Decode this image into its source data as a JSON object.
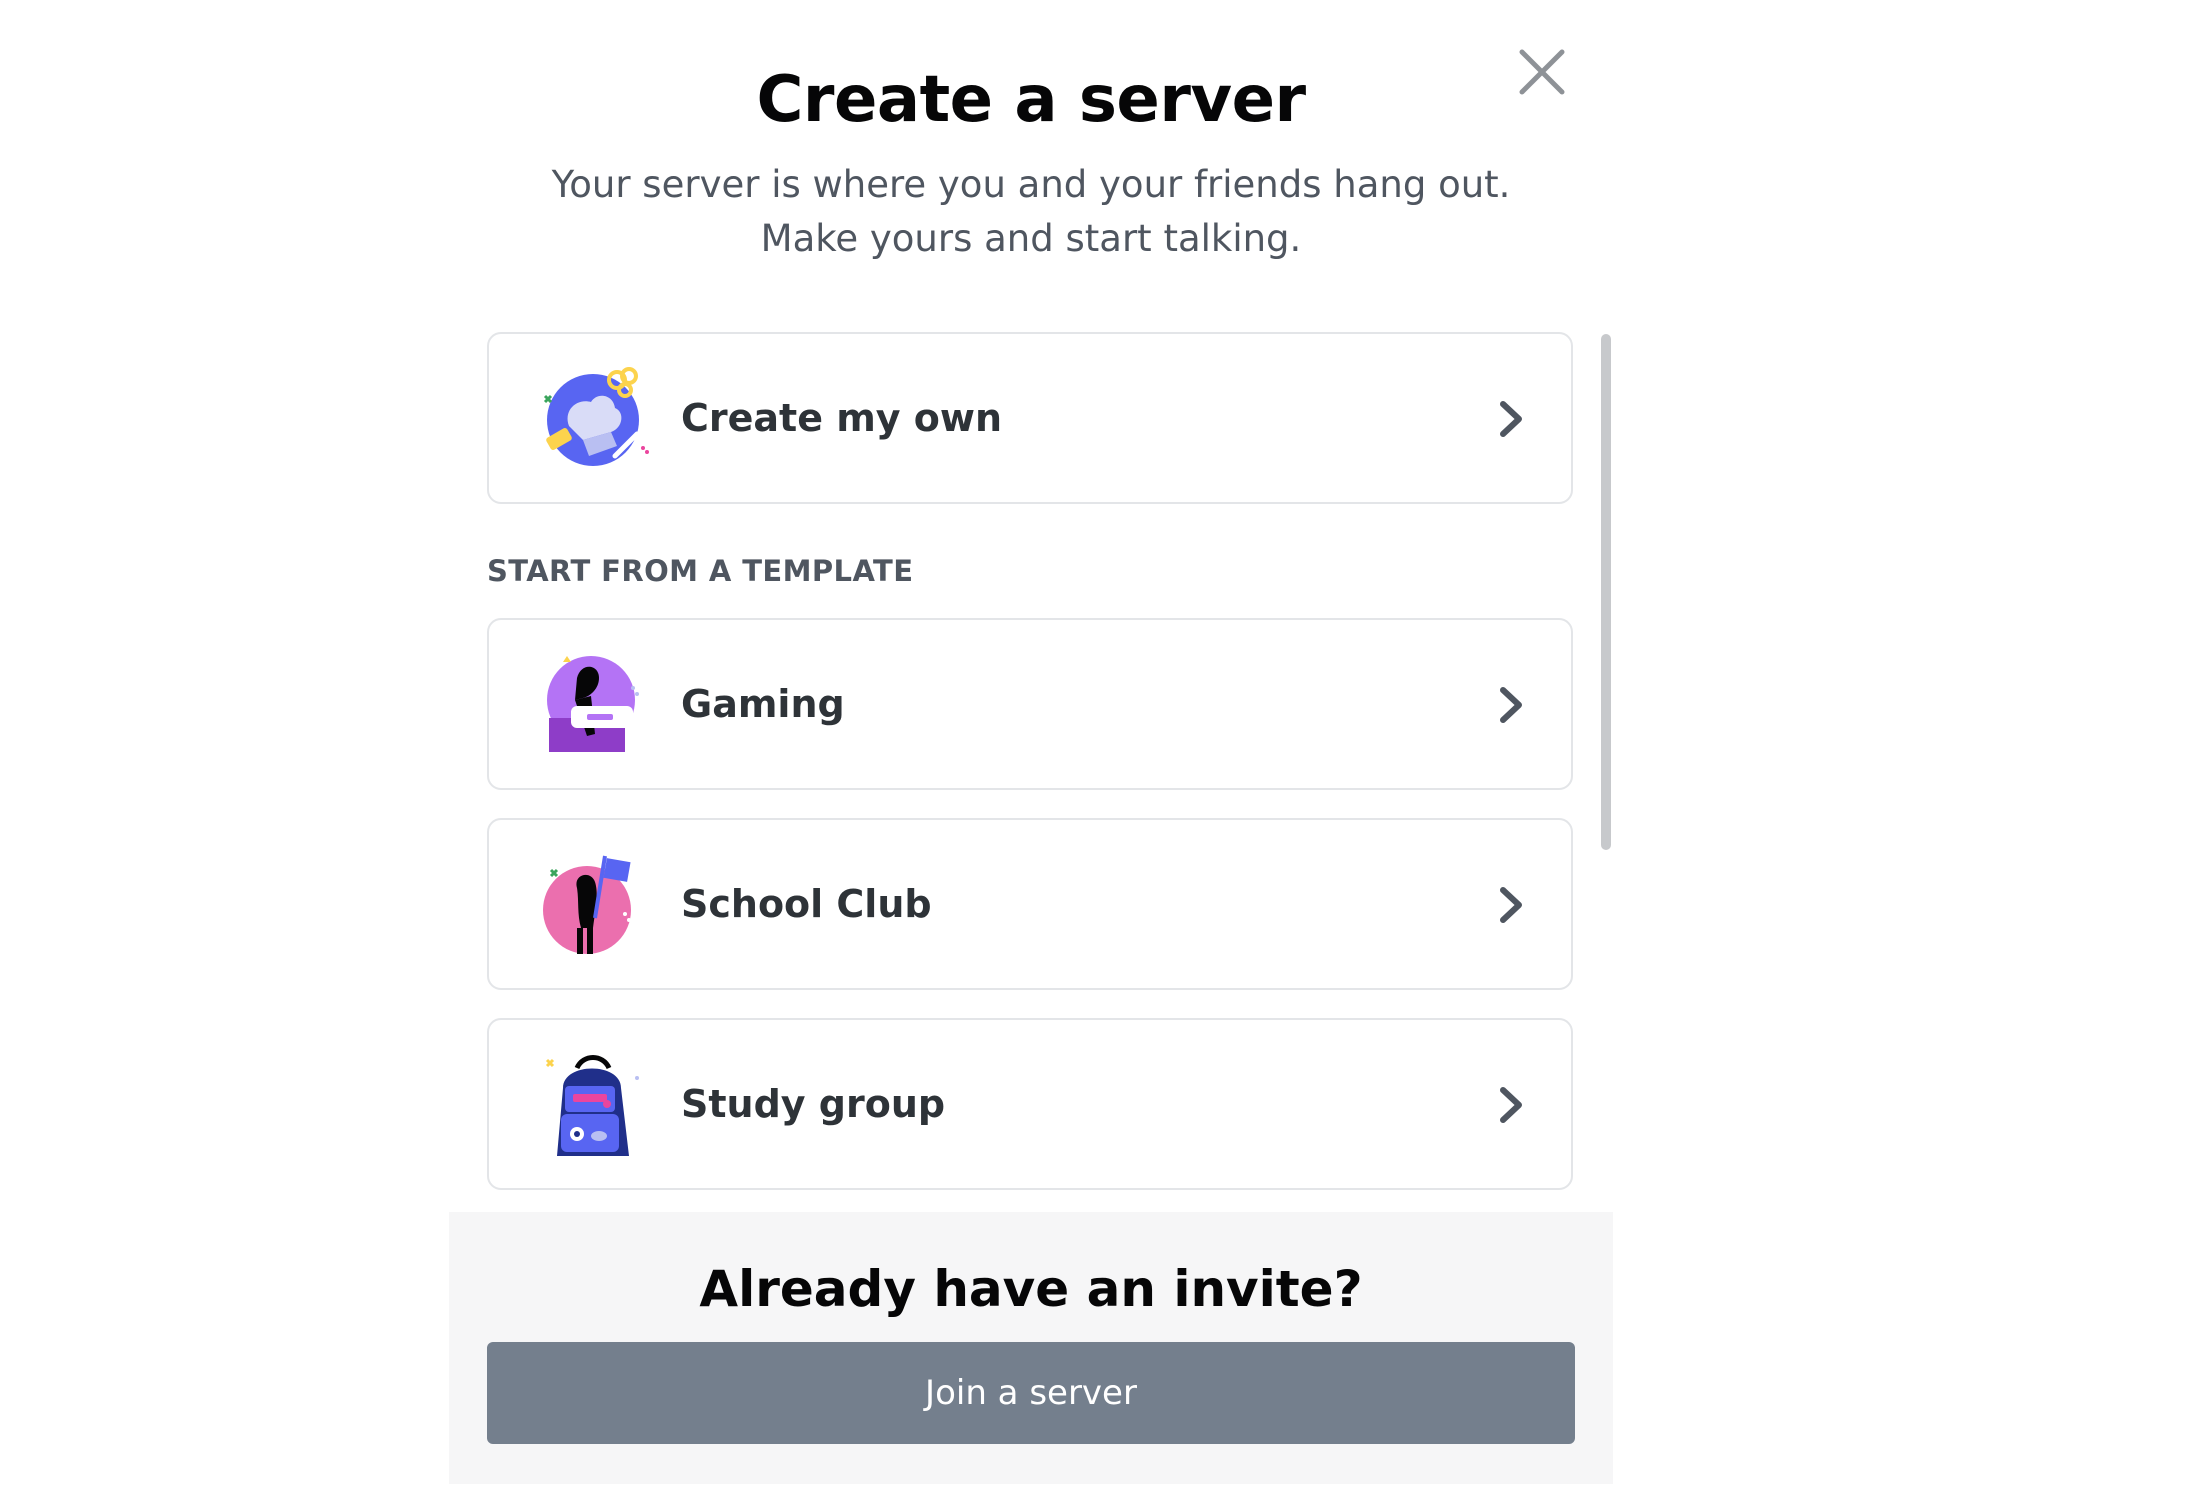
{
  "modal": {
    "title": "Create a server",
    "subtitle": "Your server is where you and your friends hang out. Make yours and start talking."
  },
  "options": {
    "create_own": {
      "label": "Create my own",
      "icon": "create-own-illustration"
    },
    "section_header": "START FROM A TEMPLATE",
    "templates": [
      {
        "label": "Gaming",
        "icon": "gaming-illustration"
      },
      {
        "label": "School Club",
        "icon": "school-club-illustration"
      },
      {
        "label": "Study group",
        "icon": "study-group-illustration"
      }
    ]
  },
  "footer": {
    "title": "Already have an invite?",
    "join_button": "Join a server"
  },
  "colors": {
    "title_text": "#060607",
    "muted_text": "#4f5660",
    "option_border": "#e3e5e8",
    "footer_bg": "#f6f6f7",
    "join_button_bg": "#747f8d",
    "blurple": "#5865f2"
  }
}
